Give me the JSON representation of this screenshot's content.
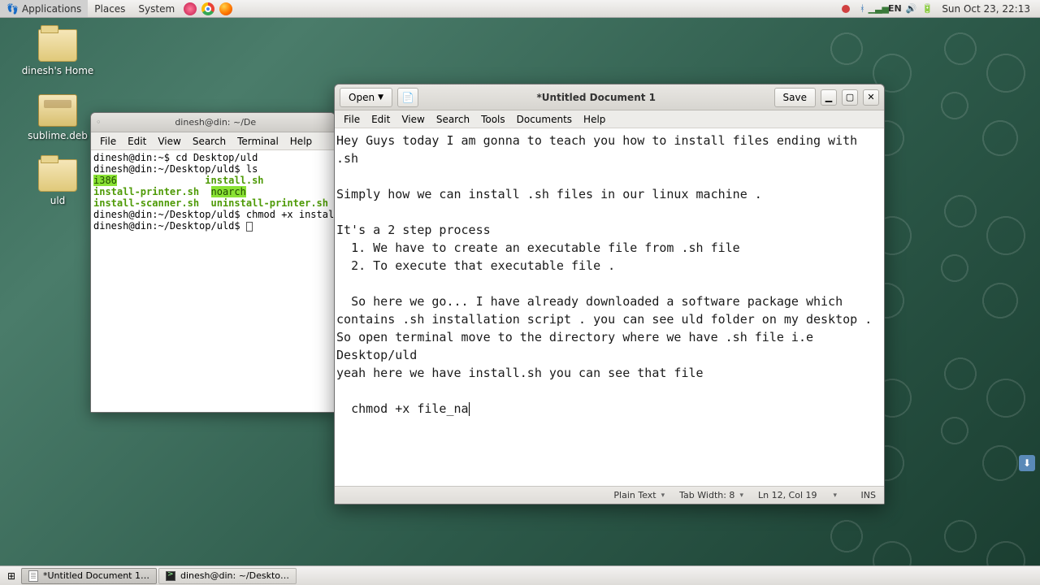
{
  "panel": {
    "menus": [
      "Applications",
      "Places",
      "System"
    ],
    "lang": "EN",
    "clock": "Sun Oct 23, 22:13"
  },
  "desktop_icons": {
    "home": "dinesh's Home",
    "sublime": "sublime.deb",
    "uld": "uld"
  },
  "terminal": {
    "title": "dinesh@din: ~/De",
    "menus": [
      "File",
      "Edit",
      "View",
      "Search",
      "Terminal",
      "Help"
    ],
    "lines": {
      "l1": "dinesh@din:~$ cd Desktop/uld",
      "l2": "dinesh@din:~/Desktop/uld$ ls",
      "l3a": "i386",
      "l3b": "install.sh",
      "l4a": "install-printer.sh",
      "l4b": "noarch",
      "l5a": "install-scanner.sh",
      "l5b": "uninstall-printer.sh",
      "l6": "dinesh@din:~/Desktop/uld$ chmod +x instal",
      "l7": "dinesh@din:~/Desktop/uld$ "
    }
  },
  "gedit": {
    "open": "Open",
    "title": "*Untitled Document 1",
    "save": "Save",
    "menus": [
      "File",
      "Edit",
      "View",
      "Search",
      "Tools",
      "Documents",
      "Help"
    ],
    "body": "Hey Guys today I am gonna to teach you how to install files ending with .sh\n\nSimply how we can install .sh files in our linux machine .\n\nIt's a 2 step process\n  1. We have to create an executable file from .sh file\n  2. To execute that executable file .\n\n  So here we go... I have already downloaded a software package which contains .sh installation script . you can see uld folder on my desktop . So open terminal move to the directory where we have .sh file i.e Desktop/uld\nyeah here we have install.sh you can see that file\n\n  chmod +x file_na",
    "status": {
      "syntax": "Plain Text",
      "tab": "Tab Width: 8",
      "pos": "Ln 12, Col 19",
      "ins": "INS"
    }
  },
  "taskbar": {
    "gedit": "*Untitled Document 1…",
    "term": "dinesh@din: ~/Deskto…"
  }
}
